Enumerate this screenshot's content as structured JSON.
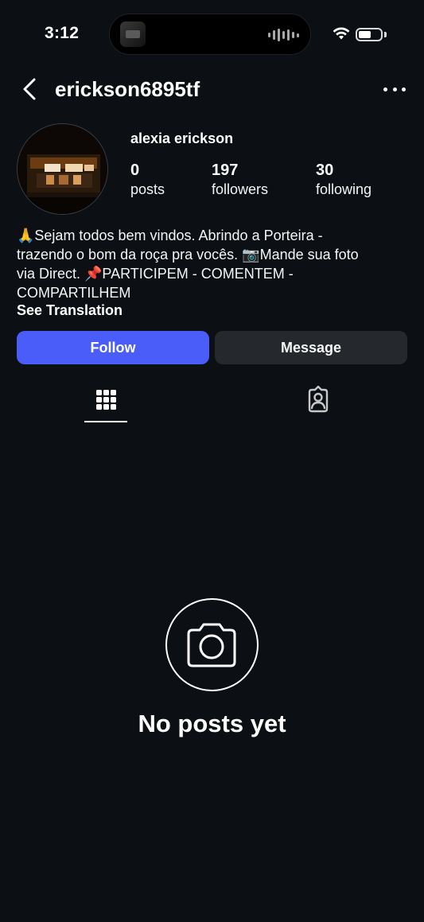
{
  "status_bar": {
    "time": "3:12",
    "wifi_icon": "wifi-icon",
    "battery_icon": "battery-icon"
  },
  "header": {
    "back_icon": "chevron-left-icon",
    "username": "erickson6895tf",
    "more_icon": "more-horizontal-icon"
  },
  "profile": {
    "display_name": "alexia erickson",
    "stats": [
      {
        "value": "0",
        "label": "posts"
      },
      {
        "value": "197",
        "label": "followers"
      },
      {
        "value": "30",
        "label": "following"
      }
    ],
    "bio_lines": [
      "🙏Sejam todos bem vindos. Abrindo a Porteira -",
      "trazendo o bom da roça pra vocês. 📷Mande sua foto",
      "via Direct. 📌PARTICIPEM - COMENTEM -",
      "COMPARTILHEM"
    ],
    "see_translation": "See Translation"
  },
  "actions": {
    "follow_label": "Follow",
    "message_label": "Message"
  },
  "tabs": [
    {
      "icon": "grid-icon",
      "active": true
    },
    {
      "icon": "tagged-person-icon",
      "active": false
    }
  ],
  "empty_state": {
    "icon": "camera-icon",
    "title": "No posts yet"
  },
  "colors": {
    "background": "#0c1014",
    "follow_button": "#4a5df9",
    "message_button": "#25292e"
  }
}
